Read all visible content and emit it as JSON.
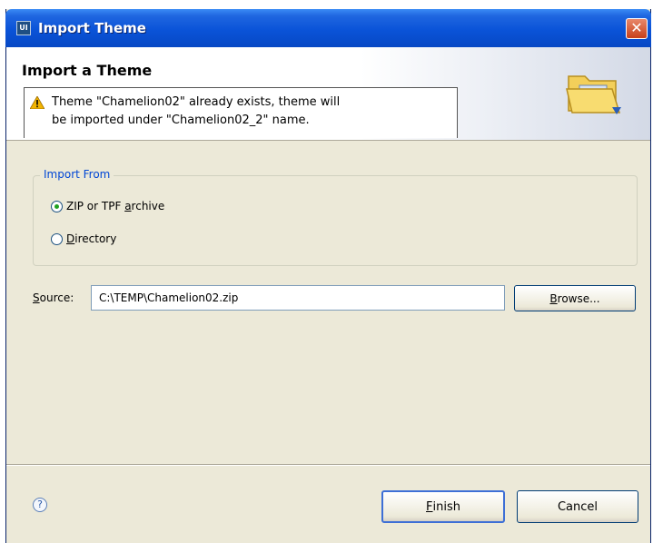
{
  "window": {
    "title": "Import Theme",
    "app_icon_text": "UI",
    "close_glyph": "✕"
  },
  "banner": {
    "title": "Import a Theme",
    "message_line1": "Theme \"Chamelion02\" already exists, theme will",
    "message_line2": "be imported under \"Chamelion02_2\" name.",
    "warning_icon": "warning-triangle-icon",
    "wizard_icon": "folder-icon"
  },
  "import_from": {
    "group_label": "Import From",
    "options": [
      {
        "label_prefix": "ZIP or TPF ",
        "label_mnemonic": "a",
        "label_suffix": "rchive",
        "selected": true
      },
      {
        "label_prefix": "",
        "label_mnemonic": "D",
        "label_suffix": "irectory",
        "selected": false
      }
    ]
  },
  "source": {
    "label_mnemonic": "S",
    "label_rest": "ource:",
    "value": "C:\\TEMP\\Chamelion02.zip",
    "browse_mnemonic": "B",
    "browse_rest": "rowse..."
  },
  "footer": {
    "help_glyph": "?",
    "finish_mnemonic": "F",
    "finish_rest": "inish",
    "cancel_label": "Cancel"
  },
  "colors": {
    "title_bar": "#0a53d8",
    "group_title": "#0046d5",
    "dialog_bg": "#ece9d8"
  }
}
